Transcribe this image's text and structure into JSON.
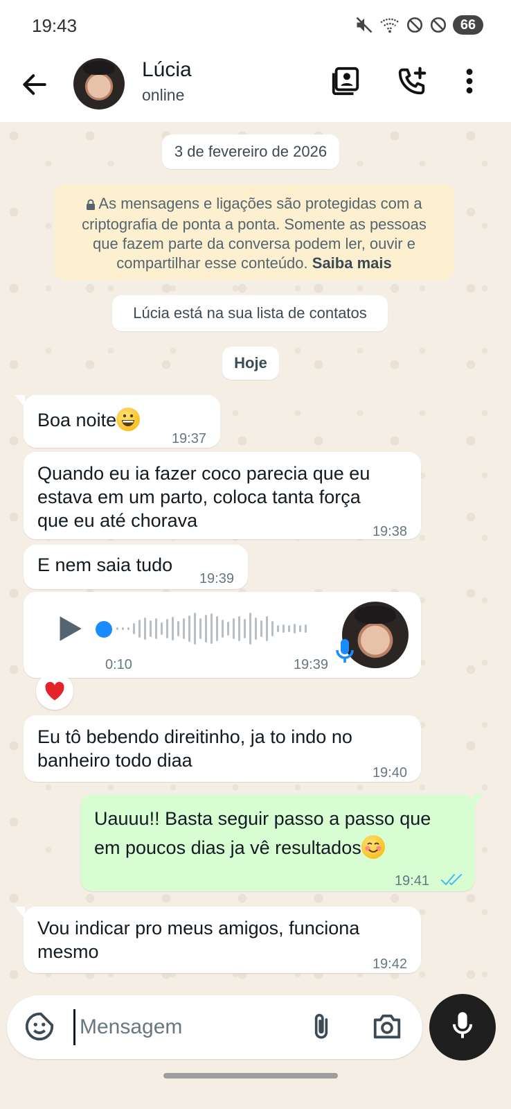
{
  "status_bar": {
    "time": "19:43",
    "battery": "66",
    "icons": [
      "mute-icon",
      "wifi-icon",
      "no-signal-icon",
      "no-signal-icon",
      "battery-icon"
    ]
  },
  "header": {
    "contact_name": "Lúcia",
    "contact_status": "online",
    "icons": [
      "back-arrow-icon",
      "contact-card-icon",
      "add-call-icon",
      "more-vert-icon"
    ]
  },
  "chat": {
    "date_chip": "3 de fevereiro de 2026",
    "encryption_notice": "As mensagens e ligações são protegidas com a criptografia de ponta a ponta. Somente as pessoas que fazem parte da conversa podem ler, ouvir e compartilhar esse conteúdo.",
    "encryption_link": "Saiba mais",
    "contact_notice": "Lúcia está na sua lista de contatos",
    "today_chip": "Hoje",
    "messages": [
      {
        "direction": "in",
        "text": "Boa noite",
        "emoji": "grinning-face",
        "time": "19:37"
      },
      {
        "direction": "in",
        "lines": [
          "Quando eu ia fazer coco parecia que eu",
          "estava em um parto, coloca tanta força",
          "que eu até chorava"
        ],
        "time": "19:38"
      },
      {
        "direction": "in",
        "text": "E nem saia tudo",
        "time": "19:39"
      },
      {
        "direction": "in",
        "type": "audio",
        "duration": "0:10",
        "time": "19:39",
        "progress": 0.0,
        "reaction": "red-heart"
      },
      {
        "direction": "in",
        "lines": [
          "Eu tô bebendo direitinho, ja to indo no",
          "banheiro todo diaa"
        ],
        "time": "19:40"
      },
      {
        "direction": "out",
        "lines": [
          "Uauuu!! Basta seguir passo a passo que",
          "em poucos dias ja vê resultados"
        ],
        "emoji": "smiling-face",
        "time": "19:41",
        "status": "read"
      },
      {
        "direction": "in",
        "lines": [
          "Vou indicar pro meus amigos, funciona",
          "mesmo"
        ],
        "time": "19:42"
      }
    ]
  },
  "composer": {
    "placeholder": "Mensagem",
    "icons": [
      "sticker-icon",
      "attach-icon",
      "camera-icon",
      "mic-icon"
    ]
  },
  "colors": {
    "outgoing_bubble": "#d9fdd3",
    "incoming_bubble": "#ffffff",
    "encryption_bg": "#fdf0d1",
    "read_ticks": "#53bdeb",
    "audio_progress": "#1a8cff"
  }
}
